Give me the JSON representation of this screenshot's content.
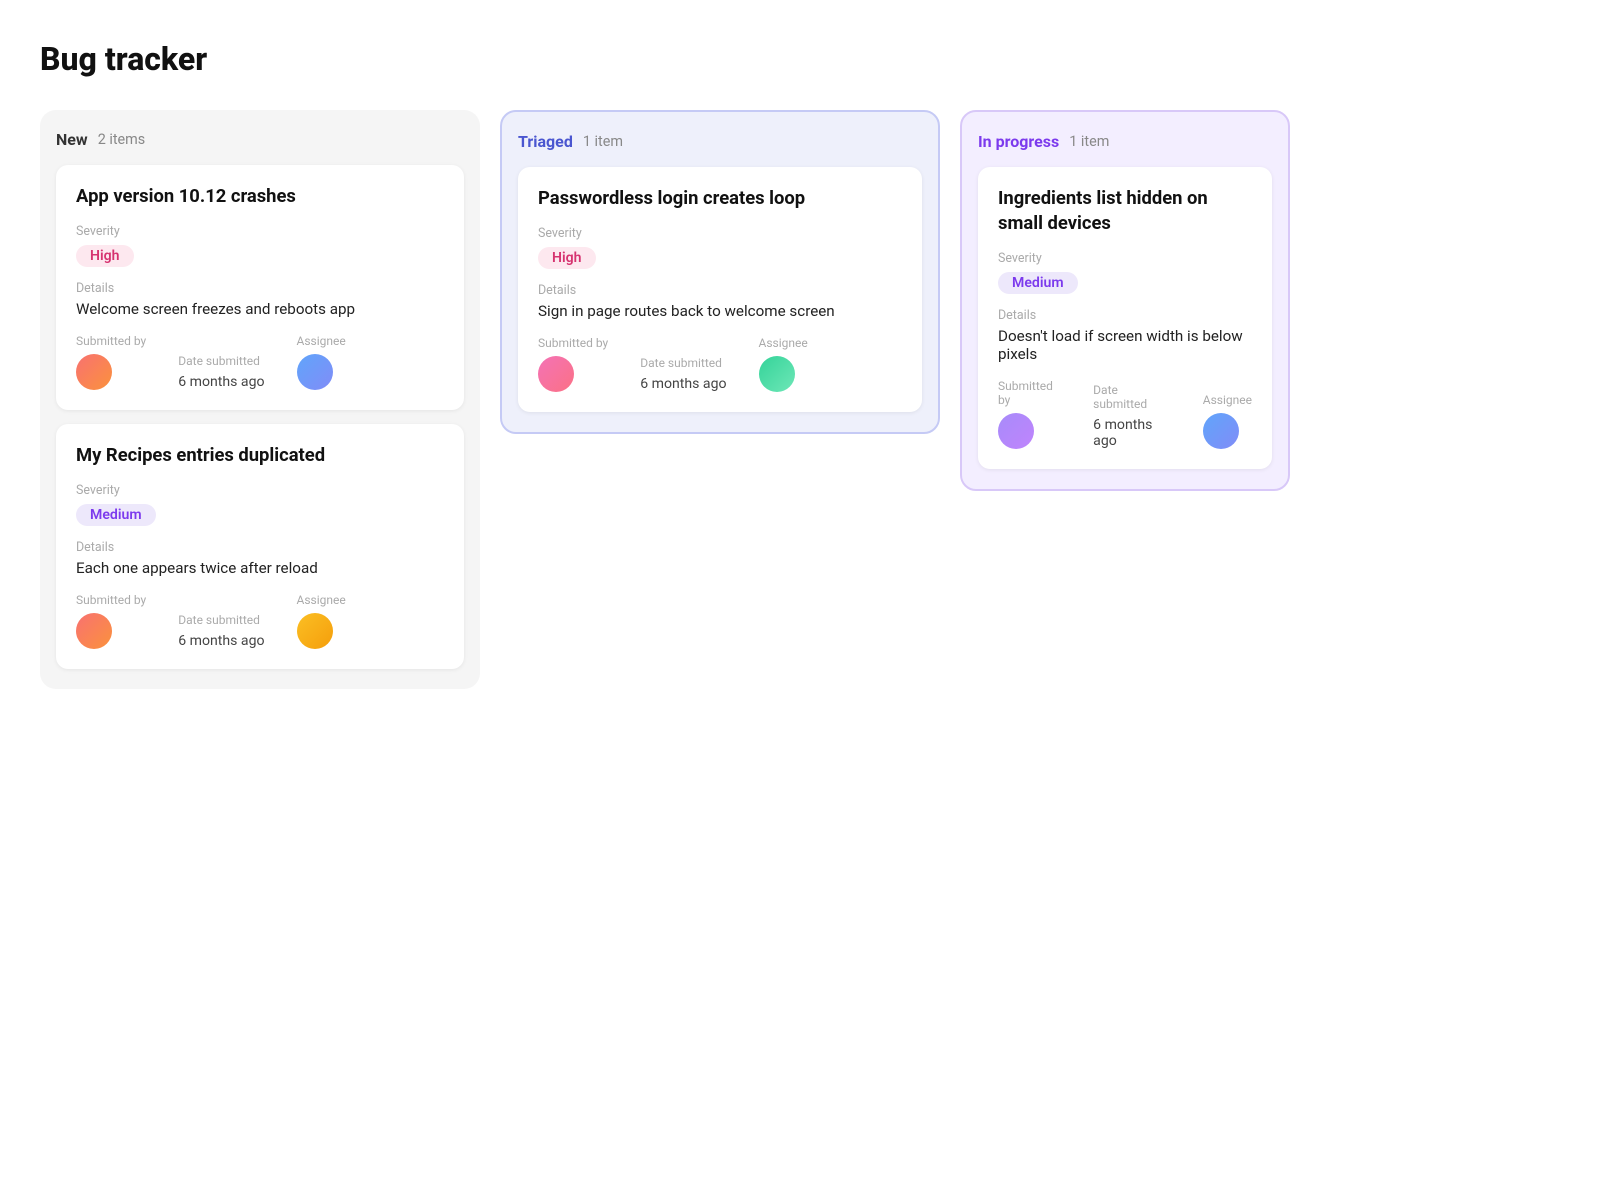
{
  "page": {
    "title": "Bug tracker"
  },
  "columns": [
    {
      "id": "new",
      "title": "New",
      "count": "2 items",
      "theme": "new",
      "cards": [
        {
          "id": "card-1",
          "title": "App version 10.12 crashes",
          "severity_label": "Severity",
          "severity": "High",
          "severity_type": "high",
          "details_label": "Details",
          "details": "Welcome screen freezes and reboots app",
          "submitted_by_label": "Submitted by",
          "date_submitted_label": "Date submitted",
          "date_submitted": "6 months ago",
          "assignee_label": "Assignee",
          "submitter_avatar": "1",
          "assignee_avatar": "2"
        },
        {
          "id": "card-2",
          "title": "My Recipes entries duplicated",
          "severity_label": "Severity",
          "severity": "Medium",
          "severity_type": "medium",
          "details_label": "Details",
          "details": "Each one appears twice after reload",
          "submitted_by_label": "Submitted by",
          "date_submitted_label": "Date submitted",
          "date_submitted": "6 months ago",
          "assignee_label": "Assignee",
          "submitter_avatar": "1",
          "assignee_avatar": "6"
        }
      ]
    },
    {
      "id": "triaged",
      "title": "Triaged",
      "count": "1 item",
      "theme": "triaged",
      "cards": [
        {
          "id": "card-3",
          "title": "Passwordless login creates loop",
          "severity_label": "Severity",
          "severity": "High",
          "severity_type": "high",
          "details_label": "Details",
          "details": "Sign in page routes back to welcome screen",
          "submitted_by_label": "Submitted by",
          "date_submitted_label": "Date submitted",
          "date_submitted": "6 months ago",
          "assignee_label": "Assignee",
          "submitter_avatar": "5",
          "assignee_avatar": "3"
        }
      ]
    },
    {
      "id": "inprogress",
      "title": "In progress",
      "count": "1 item",
      "theme": "inprogress",
      "cards": [
        {
          "id": "card-4",
          "title": "Ingredients list hidden on small devices",
          "severity_label": "Severity",
          "severity": "Medium",
          "severity_type": "medium",
          "details_label": "Details",
          "details": "Doesn't load if screen width is below pixels",
          "submitted_by_label": "Submitted by",
          "date_submitted_label": "Date submitted",
          "date_submitted": "6 months ago",
          "assignee_label": "Assignee",
          "submitter_avatar": "4",
          "assignee_avatar": "2"
        }
      ]
    }
  ]
}
